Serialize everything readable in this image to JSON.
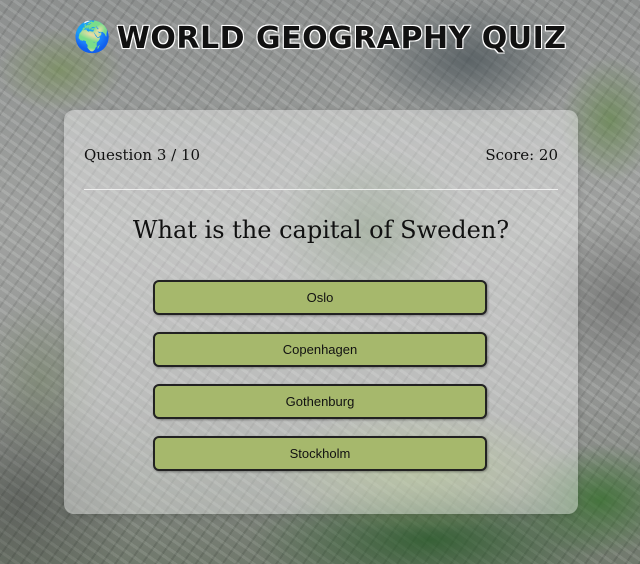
{
  "title": {
    "icon": "globe-icon",
    "glyph": "🌍",
    "text": "WORLD GEOGRAPHY QUIZ"
  },
  "quiz": {
    "progress": "Question 3 / 10",
    "score": "Score: 20",
    "question": "What is the capital of Sweden?",
    "answers": [
      {
        "label": "Oslo"
      },
      {
        "label": "Copenhagen"
      },
      {
        "label": "Gothenburg"
      },
      {
        "label": "Stockholm"
      }
    ]
  },
  "colors": {
    "answer_bg": "#a6b86c",
    "answer_border": "#222222"
  }
}
